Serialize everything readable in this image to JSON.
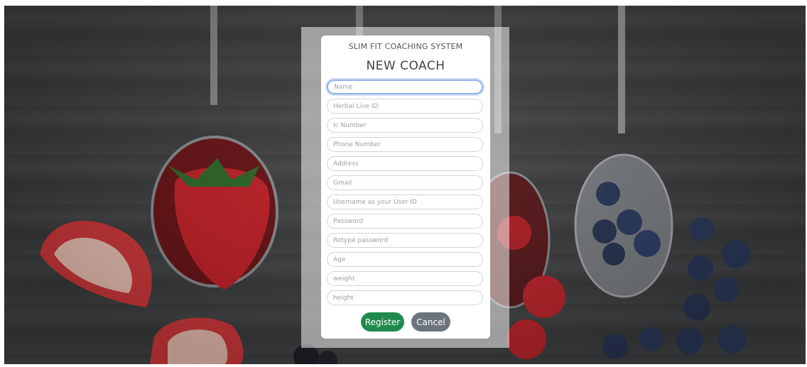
{
  "header": {
    "subtitle": "SLIM FIT COACHING SYSTEM",
    "title": "NEW COACH"
  },
  "form": {
    "fields": [
      {
        "placeholder": "Name",
        "value": ""
      },
      {
        "placeholder": "Herbal Live ID",
        "value": ""
      },
      {
        "placeholder": "Ic Number",
        "value": ""
      },
      {
        "placeholder": "Phone Number",
        "value": ""
      },
      {
        "placeholder": "Address",
        "value": ""
      },
      {
        "placeholder": "Gmail",
        "value": ""
      },
      {
        "placeholder": "Username as your User ID",
        "value": ""
      },
      {
        "placeholder": "Password",
        "value": ""
      },
      {
        "placeholder": "Retype password",
        "value": ""
      },
      {
        "placeholder": "Age",
        "value": ""
      },
      {
        "placeholder": "weight",
        "value": ""
      },
      {
        "placeholder": "height",
        "value": ""
      }
    ]
  },
  "actions": {
    "register_label": "Register",
    "cancel_label": "Cancel"
  },
  "colors": {
    "register": "#1f8a4c",
    "cancel": "#6c757d",
    "focus": "#8fb3e8"
  }
}
